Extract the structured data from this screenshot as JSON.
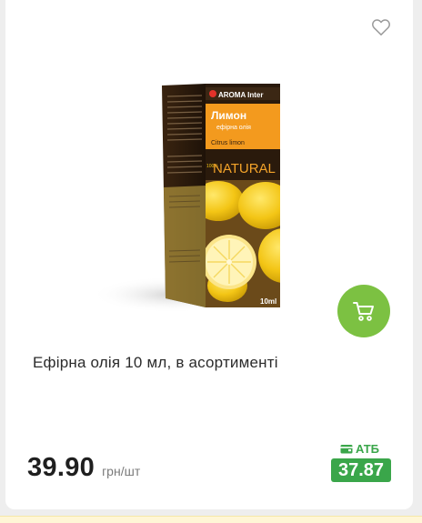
{
  "product": {
    "title": "Ефірна олія 10 мл, в асортименті",
    "price": "39.90",
    "unit": "грн/шт",
    "atb_label": "АТБ",
    "atb_price": "37.87"
  },
  "package": {
    "brand": "AROMA Inter",
    "name": "Лимон",
    "subtitle": "ефірна олія",
    "latin": "Citrus limon",
    "natural": "NATURAL",
    "natural_prefix": "100%",
    "volume": "10ml"
  },
  "icons": {
    "favorite": "heart-outline-icon",
    "cart": "cart-icon",
    "wallet": "wallet-icon"
  },
  "colors": {
    "accent_green": "#7cc142",
    "atb_green": "#3aa64a",
    "package_orange": "#f39a1e"
  }
}
